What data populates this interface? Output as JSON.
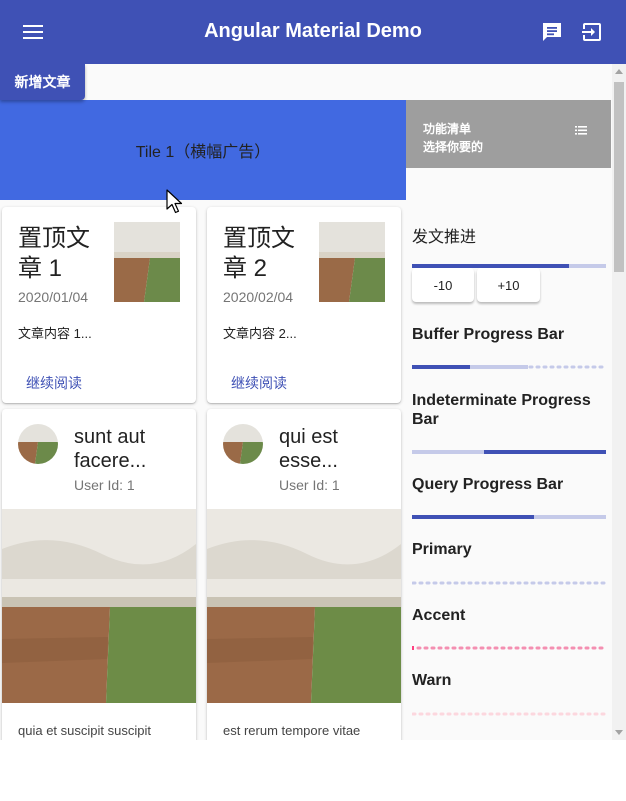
{
  "toolbar": {
    "title": "Angular Material Demo",
    "menu_icon": "menu-icon",
    "chat_icon": "chat-icon",
    "logout_icon": "logout-icon",
    "color": "#3f51b5"
  },
  "add_tab": {
    "label": "新增文章"
  },
  "tiles": {
    "banner": "Tile 1（横幅广告）",
    "banner_color": "#4169e1",
    "menu_line1": "功能清单",
    "menu_line2": "选择你要的",
    "menu_icon": "list-icon"
  },
  "pinned": [
    {
      "title_line1": "置顶文",
      "title_line2": "章 1",
      "date": "2020/01/04",
      "content": "文章内容 1...",
      "link": "继续阅读"
    },
    {
      "title_line1": "置顶文",
      "title_line2": "章 2",
      "date": "2020/02/04",
      "content": "文章内容 2...",
      "link": "继续阅读"
    }
  ],
  "posts": [
    {
      "title_line1": "sunt aut",
      "title_line2": "facere...",
      "user": "User Id: 1",
      "body": "quia et suscipit suscipit"
    },
    {
      "title_line1": "qui est",
      "title_line2": "esse...",
      "user": "User Id: 1",
      "body": "est rerum tempore vitae"
    }
  ],
  "side": {
    "section_title": "发文推进",
    "progress_value": 0.81,
    "buttons": [
      "-10",
      "+10"
    ],
    "bars": [
      {
        "label": "Buffer Progress Bar",
        "value": 0.3,
        "buffer": 0.6,
        "mode": "buffer"
      },
      {
        "label": "Indeterminate Progress Bar",
        "mode": "indeterminate"
      },
      {
        "label": "Query Progress Bar",
        "mode": "query"
      },
      {
        "label": "Primary",
        "color": "primary"
      },
      {
        "label": "Accent",
        "color": "accent"
      },
      {
        "label": "Warn",
        "color": "warn"
      }
    ],
    "colors": {
      "primary": "#3f51b5",
      "primary_light": "#c5cae9",
      "accent": "#ff4081",
      "accent_light": "#f8bbd0",
      "warn_light": "#fcd7de"
    }
  }
}
